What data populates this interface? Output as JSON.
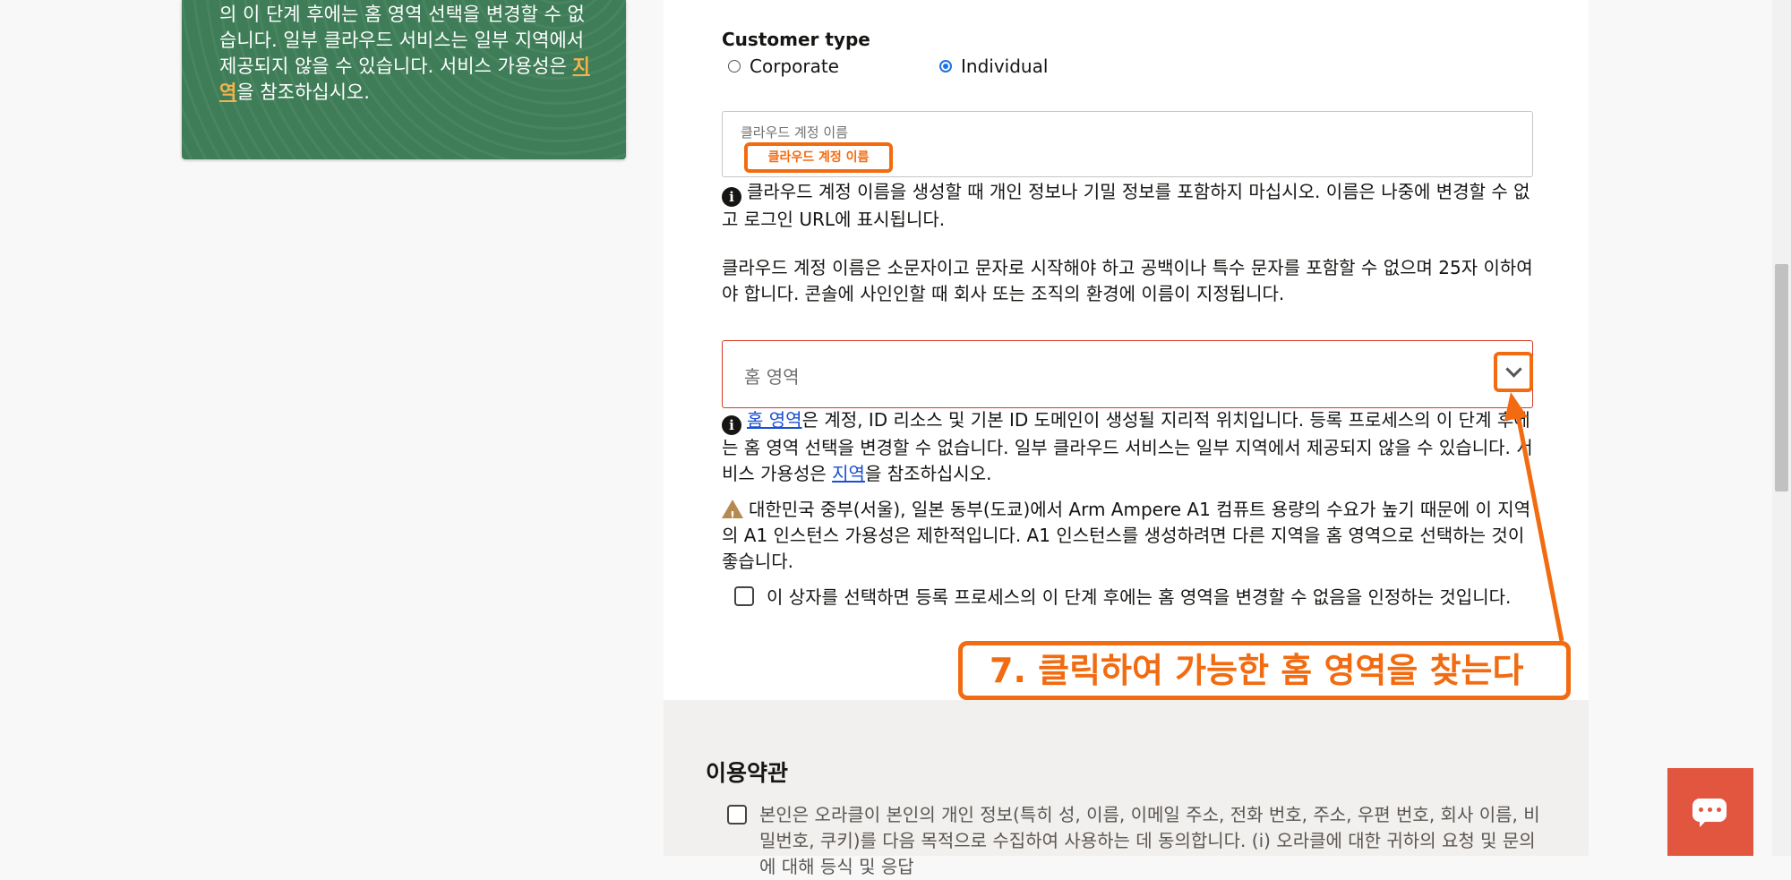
{
  "left_card": {
    "text_before": "의 이 단계 후에는 홈 영역 선택을 변경할 수 없습니다. 일부 클라우드 서비스는 일부 지역에서 제공되지 않을 수 있습니다. 서비스 가용성은 ",
    "link": "지역",
    "text_after": "을 참조하십시오."
  },
  "customer_type": {
    "label": "Customer type",
    "options": [
      "Corporate",
      "Individual"
    ],
    "selected": "Individual"
  },
  "cloud_account": {
    "label": "클라우드 계정 이름",
    "value": "클라우드 계정 이름",
    "info": "클라우드 계정 이름을 생성할 때 개인 정보나 기밀 정보를 포함하지 마십시오. 이름은 나중에 변경할 수 없고 로그인 URL에 표시됩니다.",
    "rules": "클라우드 계정 이름은 소문자이고 문자로 시작해야 하고 공백이나 특수 문자를 포함할 수 없으며 25자 이하여야 합니다. 콘솔에 사인인할 때 회사 또는 조직의 환경에 이름이 지정됩니다."
  },
  "home_region": {
    "placeholder": "홈 영역",
    "info_link": "홈 영역",
    "info_mid": "은 계정, ID 리소스 및 기본 ID 도메인이 생성될 지리적 위치입니다. 등록 프로세스의 이 단계 후에는 홈 영역 선택을 변경할 수 없습니다. 일부 클라우드 서비스는 일부 지역에서 제공되지 않을 수 있습니다. 서비스 가용성은 ",
    "info_link2": "지역",
    "info_end": "을 참조하십시오.",
    "warning": "대한민국 중부(서울), 일본 동부(도쿄)에서 Arm Ampere A1 컴퓨트 용량의 수요가 높기 때문에 이 지역의 A1 인스턴스 가용성은 제한적입니다. A1 인스턴스를 생성하려면 다른 지역을 홈 영역으로 선택하는 것이 좋습니다.",
    "ack": "이 상자를 선택하면 등록 프로세스의 이 단계 후에는 홈 영역을 변경할 수 없음을 인정하는 것입니다."
  },
  "callout": "7. 클릭하여 가능한 홈 영역을 찾는다",
  "terms": {
    "title": "이용약관",
    "text": "본인은 오라클이 본인의 개인 정보(특히 성, 이름, 이메일 주소, 전화 번호, 주소, 우편 번호, 회사 이름, 비밀번호, 쿠키)를 다음 목적으로 수집하여 사용하는 데 동의합니다. (i) 오라클에 대한 귀하의 요청 및 문의에 대해 등식 및 응답"
  },
  "colors": {
    "accent_orange": "#f26b10",
    "card_green": "#3e7d57",
    "chat_red": "#e2553e",
    "error_border": "#d63b25"
  },
  "icons": [
    "info-icon",
    "warning-icon",
    "chevron-down-icon",
    "chat-icon"
  ]
}
